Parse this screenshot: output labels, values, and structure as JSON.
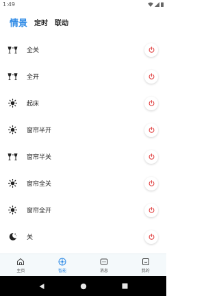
{
  "status_bar": {
    "time": "1:49"
  },
  "tabs": [
    {
      "label": "情景",
      "active": true
    },
    {
      "label": "定时",
      "active": false
    },
    {
      "label": "联动",
      "active": false
    }
  ],
  "scenes": [
    {
      "label": "全关",
      "icon": "wine-glasses-icon"
    },
    {
      "label": "全开",
      "icon": "wine-glasses-icon"
    },
    {
      "label": "起床",
      "icon": "sun-icon"
    },
    {
      "label": "窗帘半开",
      "icon": "sun-icon"
    },
    {
      "label": "窗帘半关",
      "icon": "wine-glasses-icon"
    },
    {
      "label": "窗帘全关",
      "icon": "sun-icon"
    },
    {
      "label": "窗帘全开",
      "icon": "sun-icon"
    },
    {
      "label": "关",
      "icon": "moon-icon"
    }
  ],
  "bottom_nav": [
    {
      "label": "主页",
      "icon": "home-icon",
      "active": false
    },
    {
      "label": "智能",
      "icon": "smart-icon",
      "active": true
    },
    {
      "label": "消息",
      "icon": "message-icon",
      "active": false
    },
    {
      "label": "我的",
      "icon": "profile-icon",
      "active": false
    }
  ],
  "colors": {
    "accent": "#2f8be6",
    "power": "#e24a4a",
    "nav_background": "#f4f9fb"
  }
}
